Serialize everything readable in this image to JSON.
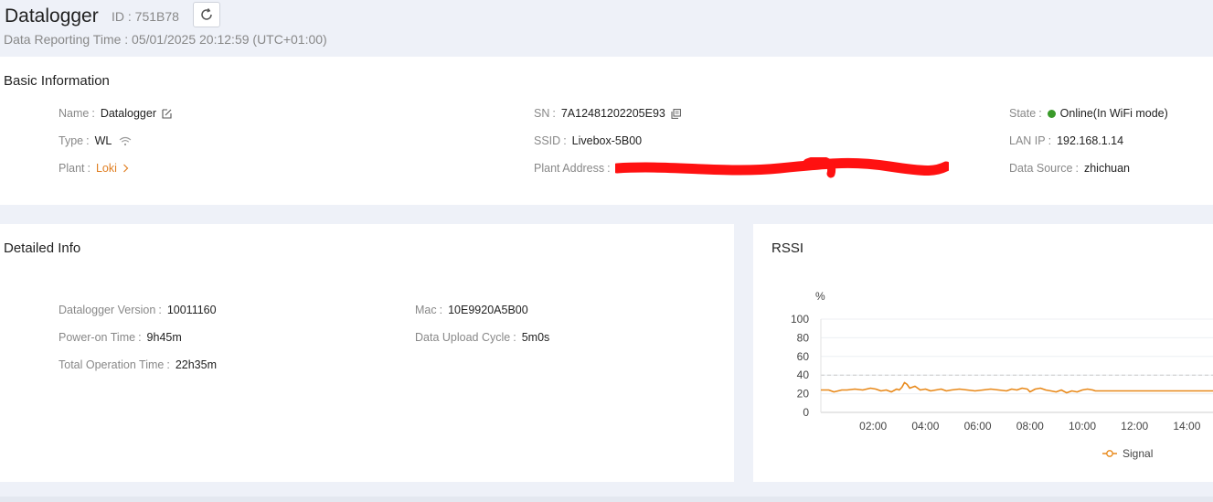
{
  "header": {
    "title": "Datalogger",
    "id_text": "ID : 751B78",
    "report_time": "Data Reporting Time : 05/01/2025 20:12:59 (UTC+01:00)"
  },
  "basic": {
    "title": "Basic Information",
    "name_label": "Name",
    "name_value": "Datalogger",
    "type_label": "Type",
    "type_value": "WL",
    "plant_label": "Plant",
    "plant_value": "Loki",
    "sn_label": "SN",
    "sn_value": "7A12481202205E93",
    "ssid_label": "SSID",
    "ssid_value": "Livebox-5B00",
    "plant_address_label": "Plant Address",
    "state_label": "State",
    "state_value": "Online(In WiFi mode)",
    "state_color": "#3a9a2a",
    "lan_ip_label": "LAN IP",
    "lan_ip_value": "192.168.1.14",
    "data_source_label": "Data Source",
    "data_source_value": "zhichuan"
  },
  "detail": {
    "title": "Detailed Info",
    "version_label": "Datalogger Version",
    "version_value": "10011160",
    "power_on_label": "Power-on Time",
    "power_on_value": "9h45m",
    "total_op_label": "Total Operation Time",
    "total_op_value": "22h35m",
    "mac_label": "Mac",
    "mac_value": "10E9920A5B00",
    "upload_label": "Data Upload Cycle",
    "upload_value": "5m0s"
  },
  "rssi": {
    "title": "RSSI"
  },
  "chart_data": {
    "type": "line",
    "ylabel": "%",
    "ylim": [
      0,
      100
    ],
    "yticks": [
      0,
      20,
      40,
      60,
      80,
      100
    ],
    "xlim": [
      0,
      15
    ],
    "xticks": [
      2,
      4,
      6,
      8,
      10,
      12,
      14
    ],
    "xtick_labels": [
      "02:00",
      "04:00",
      "06:00",
      "08:00",
      "10:00",
      "12:00",
      "14:00"
    ],
    "reference_line": 40,
    "series": [
      {
        "name": "Signal",
        "color": "#e8891a",
        "x": [
          0,
          0.3,
          0.5,
          0.8,
          1.0,
          1.3,
          1.6,
          1.9,
          2.1,
          2.3,
          2.5,
          2.7,
          2.9,
          3.0,
          3.1,
          3.2,
          3.3,
          3.4,
          3.6,
          3.8,
          4.0,
          4.2,
          4.4,
          4.6,
          4.8,
          5.0,
          5.3,
          5.6,
          5.9,
          6.2,
          6.5,
          6.8,
          7.1,
          7.3,
          7.5,
          7.7,
          7.9,
          8.0,
          8.2,
          8.4,
          8.6,
          8.8,
          9.0,
          9.2,
          9.4,
          9.6,
          9.8,
          10.0,
          10.2,
          10.4,
          10.5,
          11.0,
          12.0,
          13.0,
          14.0,
          15.0
        ],
        "values": [
          24,
          24,
          22,
          24,
          24,
          25,
          24,
          26,
          25,
          23,
          24,
          22,
          25,
          24,
          27,
          32,
          30,
          26,
          28,
          24,
          25,
          23,
          24,
          25,
          23,
          24,
          25,
          24,
          23,
          24,
          25,
          24,
          23,
          25,
          24,
          26,
          25,
          22,
          25,
          26,
          24,
          23,
          22,
          24,
          21,
          23,
          22,
          24,
          25,
          24,
          23,
          23,
          23,
          23,
          23,
          23
        ]
      }
    ]
  }
}
